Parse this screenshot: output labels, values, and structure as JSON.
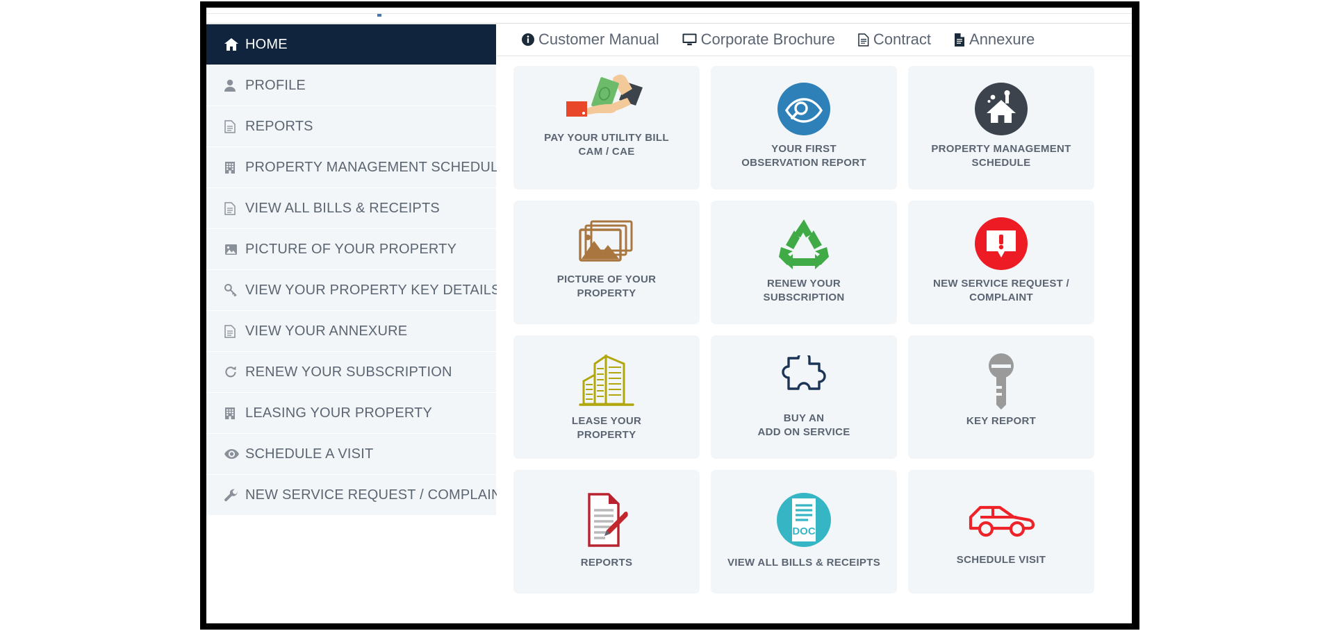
{
  "window": {
    "frame_color": "#000000",
    "background": "#ffffff"
  },
  "sidebar": {
    "active_bg": "#10243e",
    "item_bg": "#f3f6f8",
    "label_color": "#5c6672",
    "items": [
      {
        "label": "HOME",
        "icon": "home-icon",
        "active": true
      },
      {
        "label": "PROFILE",
        "icon": "user-icon",
        "active": false
      },
      {
        "label": "REPORTS",
        "icon": "file-text-icon",
        "active": false
      },
      {
        "label": "PROPERTY MANAGEMENT SCHEDULE",
        "icon": "building-icon",
        "active": false
      },
      {
        "label": "VIEW ALL BILLS & RECEIPTS",
        "icon": "file-text-icon",
        "active": false
      },
      {
        "label": "PICTURE OF YOUR PROPERTY",
        "icon": "image-icon",
        "active": false
      },
      {
        "label": "VIEW YOUR PROPERTY KEY DETAILS",
        "icon": "key-icon",
        "active": false
      },
      {
        "label": "VIEW YOUR ANNEXURE",
        "icon": "file-text-icon",
        "active": false
      },
      {
        "label": "RENEW YOUR SUBSCRIPTION",
        "icon": "refresh-icon",
        "active": false
      },
      {
        "label": "LEASING YOUR PROPERTY",
        "icon": "building-icon",
        "active": false
      },
      {
        "label": "SCHEDULE A VISIT",
        "icon": "eye-icon",
        "active": false
      },
      {
        "label": "NEW SERVICE REQUEST / COMPLAINT",
        "icon": "wrench-icon",
        "active": false
      }
    ]
  },
  "topnav": {
    "links": [
      {
        "label": "Customer Manual",
        "icon": "info-circle-icon"
      },
      {
        "label": "Corporate Brochure",
        "icon": "desktop-icon"
      },
      {
        "label": "Contract",
        "icon": "file-icon"
      },
      {
        "label": "Annexure",
        "icon": "file-bold-icon"
      }
    ]
  },
  "tiles": [
    {
      "line1": "PAY YOUR UTILITY BILL",
      "line2": "CAM / CAE",
      "icon": "hand-cash-icon",
      "colors": {
        "cash": "#6cbb6a",
        "skin": "#f4c99a",
        "wallet": "#3d434a",
        "card": "#e8472a"
      }
    },
    {
      "line1": "YOUR FIRST",
      "line2": "OBSERVATION REPORT",
      "icon": "eye-search-circle-icon",
      "colors": {
        "circle": "#2e80b8",
        "glyph": "#ffffff"
      }
    },
    {
      "line1": "PROPERTY MANAGEMENT",
      "line2": "SCHEDULE",
      "icon": "house-circle-icon",
      "colors": {
        "circle": "#3c434c",
        "glyph": "#ffffff"
      }
    },
    {
      "line1": "PICTURE OF YOUR",
      "line2": "PROPERTY",
      "icon": "photo-stack-icon",
      "colors": {
        "main": "#a9763f"
      }
    },
    {
      "line1": "RENEW YOUR",
      "line2": "SUBSCRIPTION",
      "icon": "recycle-icon",
      "colors": {
        "main": "#3faa46"
      }
    },
    {
      "line1": "NEW SERVICE REQUEST /",
      "line2": "COMPLAINT",
      "icon": "alert-circle-icon",
      "colors": {
        "circle": "#ed1c24",
        "glyph": "#ffffff"
      }
    },
    {
      "line1": "LEASE YOUR",
      "line2": "PROPERTY",
      "icon": "buildings-icon",
      "colors": {
        "main": "#b2a60d"
      }
    },
    {
      "line1": "BUY AN",
      "line2": "ADD ON SERVICE",
      "icon": "puzzle-piece-icon",
      "colors": {
        "main": "#1c3557"
      }
    },
    {
      "line1": "KEY REPORT",
      "line2": "",
      "icon": "key-solid-icon",
      "colors": {
        "main": "#9a9a9a"
      }
    },
    {
      "line1": "REPORTS",
      "line2": "",
      "icon": "document-pen-icon",
      "colors": {
        "paper": "#b8232f",
        "pen": "#c1272d",
        "lines": "#b9b9b9"
      }
    },
    {
      "line1": "VIEW ALL BILLS & RECEIPTS",
      "line2": "",
      "icon": "doc-circle-icon",
      "colors": {
        "circle": "#36b6c5",
        "glyph": "#ffffff"
      },
      "badge_text": "DOC"
    },
    {
      "line1": "SCHEDULE VISIT",
      "line2": "",
      "icon": "car-icon",
      "colors": {
        "main": "#ee2229"
      }
    }
  ]
}
